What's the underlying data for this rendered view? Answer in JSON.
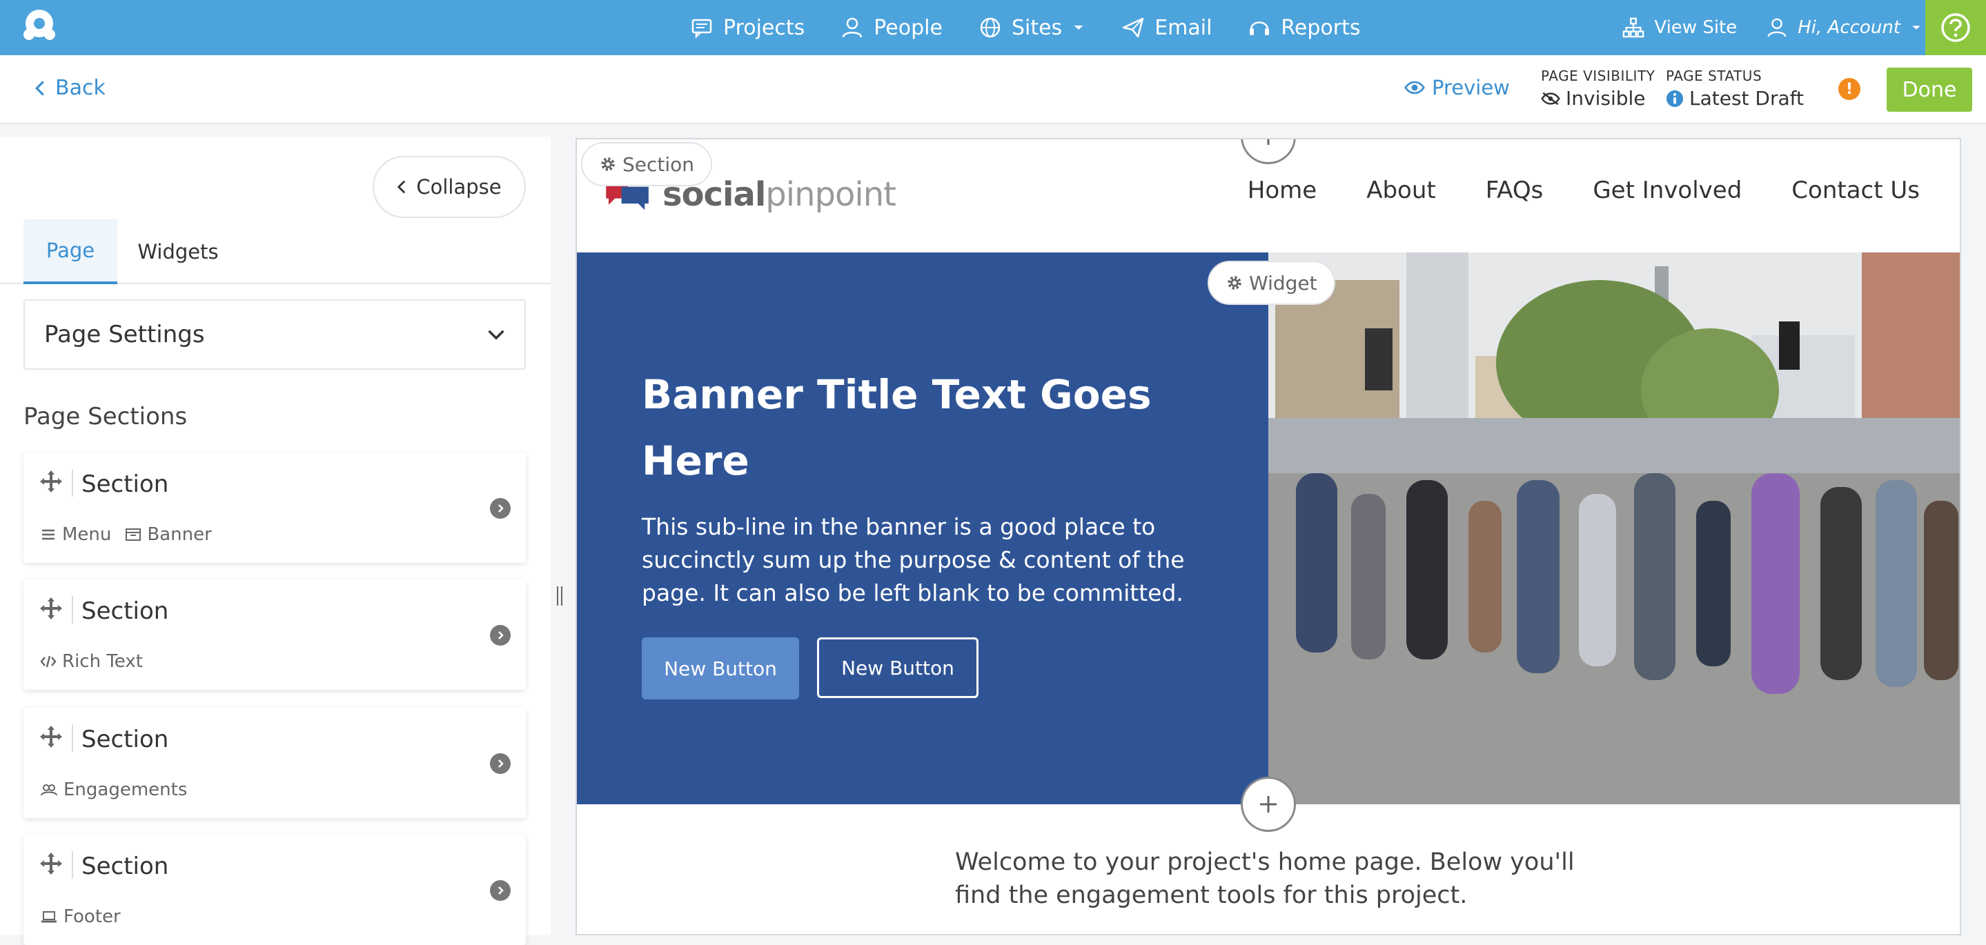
{
  "topbar": {
    "nav": [
      {
        "label": "Projects",
        "icon": "message-icon"
      },
      {
        "label": "People",
        "icon": "person-icon"
      },
      {
        "label": "Sites",
        "icon": "globe-icon"
      },
      {
        "label": "Email",
        "icon": "paper-plane-icon"
      },
      {
        "label": "Reports",
        "icon": "headset-icon"
      }
    ],
    "view_site": "View Site",
    "account": "Hi, Account"
  },
  "toolbar": {
    "back": "Back",
    "preview": "Preview",
    "visibility_label": "PAGE VISIBILITY",
    "visibility_value": "Invisible",
    "status_label": "PAGE STATUS",
    "status_value": "Latest Draft",
    "done": "Done"
  },
  "left_panel": {
    "collapse": "Collapse",
    "tabs": [
      "Page",
      "Widgets"
    ],
    "page_settings": "Page Settings",
    "sections_title": "Page Sections",
    "sections": [
      {
        "title": "Section",
        "tags": [
          {
            "label": "Menu",
            "icon": "menu-icon"
          },
          {
            "label": "Banner",
            "icon": "banner-icon"
          }
        ]
      },
      {
        "title": "Section",
        "tags": [
          {
            "label": "Rich Text",
            "icon": "code-icon"
          }
        ]
      },
      {
        "title": "Section",
        "tags": [
          {
            "label": "Engagements",
            "icon": "users-icon"
          }
        ]
      },
      {
        "title": "Section",
        "tags": [
          {
            "label": "Footer",
            "icon": "laptop-icon"
          }
        ]
      }
    ]
  },
  "canvas": {
    "section_pill": "Section",
    "widget_pill": "Widget",
    "brand_strong": "social",
    "brand_light": "pinpoint",
    "site_nav": [
      "Home",
      "About",
      "FAQs",
      "Get Involved",
      "Contact Us"
    ],
    "banner_title": "Banner Title Text Goes Here",
    "banner_sub": "This sub-line in the banner is a good place to succinctly sum up the purpose & content of the page. It can also be left blank to be committed.",
    "button_primary": "New Button",
    "button_secondary": "New Button",
    "welcome": "Welcome to your project's home page. Below you'll find the engagement tools for this project."
  }
}
